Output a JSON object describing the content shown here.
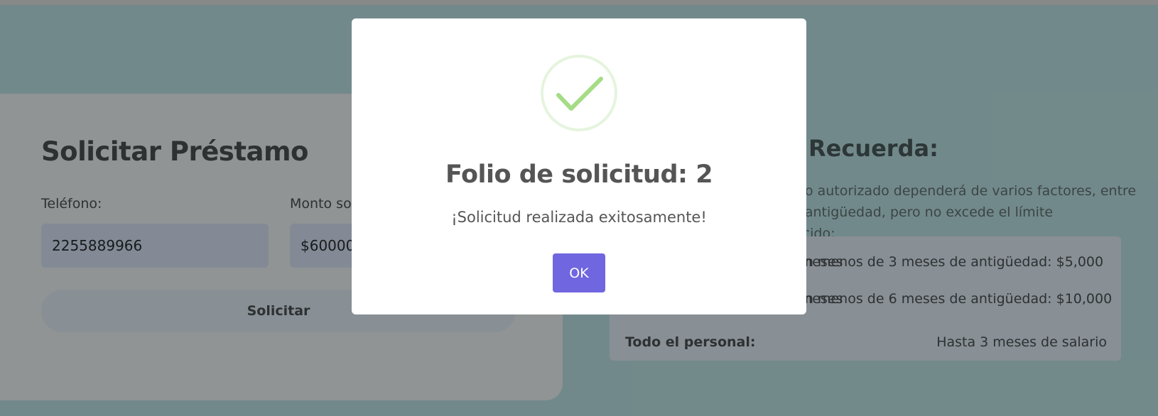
{
  "loan_form": {
    "title": "Solicitar Préstamo",
    "phone_label": "Teléfono:",
    "phone_value": "2255889966",
    "amount_label": "Monto solicitado:",
    "amount_value": "$60000",
    "submit_label": "Solicitar"
  },
  "reminder": {
    "title": "Recuerda:",
    "description": "El monto autorizado dependerá de varios factores, entre ellos el antigüedad, pero no excede el límite establecido:",
    "limits": [
      {
        "label": "Personal con menos de 3 meses",
        "value": "Con menos de 3 meses de antigüedad: $5,000"
      },
      {
        "label": "Personal con menos de 6 meses",
        "value": "Con menos de 6 meses de antigüedad: $10,000"
      },
      {
        "label": "Todo el personal:",
        "value": "Hasta 3 meses de salario"
      }
    ]
  },
  "modal": {
    "title": "Folio de solicitud: 2",
    "message": "¡Solicitud realizada exitosamente!",
    "ok_label": "OK",
    "icon": "check-circle-icon",
    "accent_color": "#7066e0",
    "success_color": "#a5dc86"
  }
}
